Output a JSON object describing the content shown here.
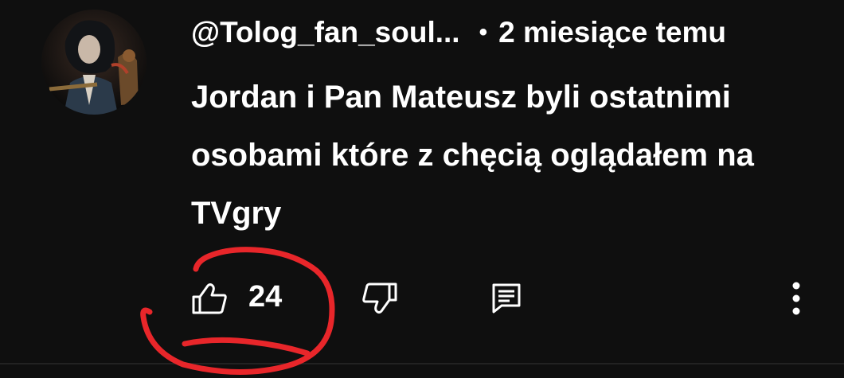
{
  "comment": {
    "author": "@Tolog_fan_soul...",
    "separator": "•",
    "timestamp": "2 miesiące temu",
    "text": "Jordan i Pan Mateusz byli ostatnimi osobami które z chęcią oglądałem na TVgry",
    "like_count": "24"
  },
  "icons": {
    "like": "thumbs-up-icon",
    "dislike": "thumbs-down-icon",
    "reply": "comment-icon",
    "more": "more-vertical-icon"
  },
  "colors": {
    "background": "#0f0f0f",
    "text": "#ffffff",
    "annotation": "#e8262a"
  }
}
